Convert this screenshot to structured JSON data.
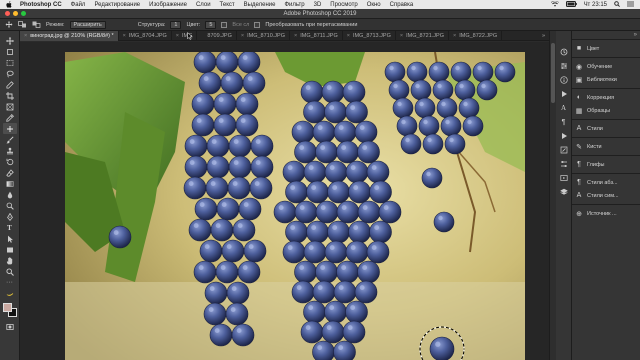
{
  "menubar": {
    "app": "Photoshop CC",
    "items": [
      "Файл",
      "Редактирование",
      "Изображение",
      "Слои",
      "Текст",
      "Выделение",
      "Фильтр",
      "3D",
      "Просмотр",
      "Окно",
      "Справка"
    ],
    "time": "Чт 23:15"
  },
  "window": {
    "title": "Adobe Photoshop CC 2019"
  },
  "options": {
    "mode_label": "Режим:",
    "mode_value": "Расширить",
    "structure_label": "Структура:",
    "structure_value": "1",
    "color_label": "Цвет:",
    "color_value": "5",
    "sample_all_label": "Все сл",
    "transform_label": "Преобразовать при перетаскивании"
  },
  "tabs": [
    {
      "label": "виноград.jpg @ 210% (RGB/8#) *",
      "active": true
    },
    {
      "label": "IMG_8704.JPG",
      "active": false
    },
    {
      "label": "IMG",
      "active": false
    },
    {
      "label": "8709.JPG",
      "active": false
    },
    {
      "label": "IMG_8710.JPG",
      "active": false
    },
    {
      "label": "IMG_8711.JPG",
      "active": false
    },
    {
      "label": "IMG_8713.JPG",
      "active": false
    },
    {
      "label": "IMG_8721.JPG",
      "active": false
    },
    {
      "label": "IMG_8722.JPG",
      "active": false
    }
  ],
  "tabs_more": "»",
  "panels": [
    {
      "icon": "color-icon",
      "glyph": "■",
      "label": "Цвет"
    },
    {
      "icon": "learn-icon",
      "glyph": "◉",
      "label": "Обучение"
    },
    {
      "icon": "libraries-icon",
      "glyph": "▣",
      "label": "Библиотеки"
    },
    {
      "icon": "adjustments-icon",
      "glyph": "◐",
      "label": "Коррекция"
    },
    {
      "icon": "swatches-icon",
      "glyph": "▦",
      "label": "Образцы"
    },
    {
      "icon": "styles-icon",
      "glyph": "A",
      "label": "Стили"
    },
    {
      "icon": "brushes-icon",
      "glyph": "✎",
      "label": "Кисти"
    },
    {
      "icon": "glyphs-icon",
      "glyph": "¶",
      "label": "Глифы"
    },
    {
      "icon": "paragraph-styles-icon",
      "glyph": "¶",
      "label": "Стили абз..."
    },
    {
      "icon": "character-styles-icon",
      "glyph": "A",
      "label": "Стили сим..."
    },
    {
      "icon": "clone-source-icon",
      "glyph": "⊕",
      "label": "Источник ..."
    }
  ],
  "colors": {
    "accent": "#3b74d9",
    "grape": "#4c5f9c",
    "leaf": "#5b8a2e"
  }
}
